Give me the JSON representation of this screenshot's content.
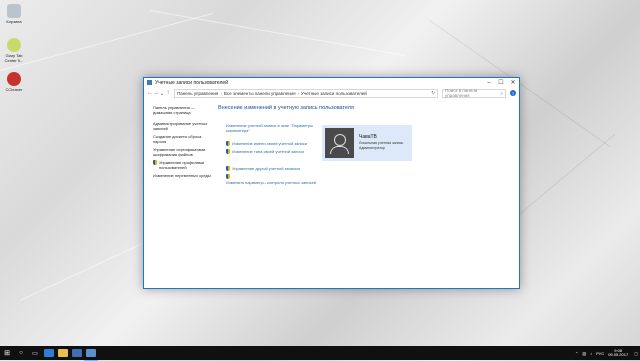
{
  "desktop": {
    "icons": [
      {
        "label": "Корзина"
      },
      {
        "label": "Glary Tab Center 5..."
      },
      {
        "label": "CCleaner"
      }
    ]
  },
  "window": {
    "title": "Учетные записи пользователей",
    "controls": {
      "minimize": "–",
      "maximize": "☐",
      "close": "✕"
    },
    "address": {
      "breadcrumb": [
        "Панель управления",
        "Все элементы панели управления",
        "Учетные записи пользователей"
      ],
      "search_placeholder": "Поиск в панели управления"
    },
    "sidebar": {
      "items": [
        "Панель управления — домашняя страница",
        "Администрирование учетных записей",
        "Создание дискеты сброса пароля",
        "Управление сертификатами шифрования файлов",
        "Управление профилями пользователей",
        "Изменение переменных среды"
      ]
    },
    "main": {
      "heading": "Внесение изменений в учетную запись пользователя",
      "links": [
        "Изменение учетной записи в окне \"Параметры компьютера\"",
        "Изменение имени своей учетной записи",
        "Изменение типа своей учетной записи",
        "Управление другой учетной записью",
        "Изменить параметры контроля учетных записей"
      ],
      "account": {
        "name": "ЧаваТВ",
        "type": "Локальная учетная запись",
        "role": "Администратор"
      }
    }
  },
  "taskbar": {
    "tray": {
      "lang": "РУС",
      "time": "9:08",
      "date": "09.05.2017"
    }
  }
}
